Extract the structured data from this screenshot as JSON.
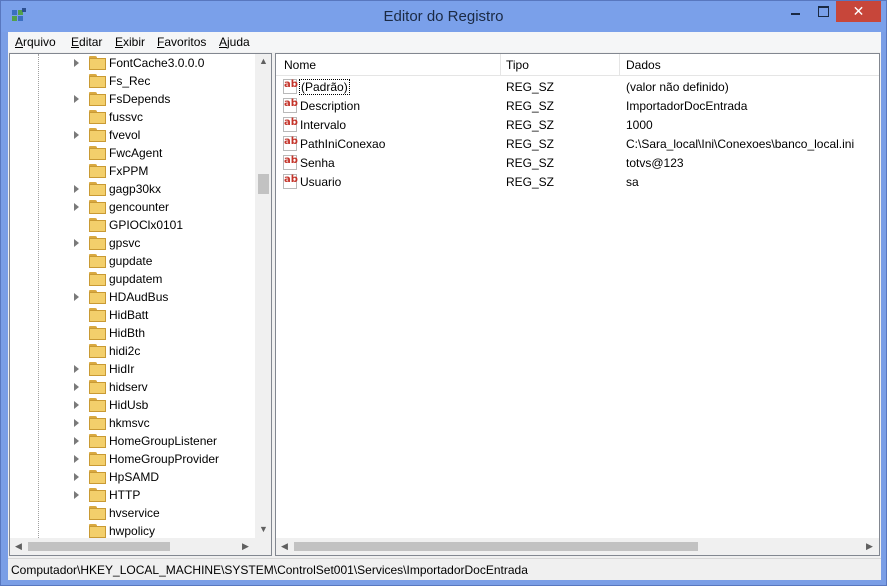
{
  "window": {
    "title": "Editor do Registro",
    "close_glyph": "✕",
    "icon": "registry-editor-icon"
  },
  "menubar": [
    {
      "accel": "A",
      "rest": "rquivo"
    },
    {
      "accel": "E",
      "rest": "ditar"
    },
    {
      "accel": "E",
      "rest": "xibir"
    },
    {
      "accel": "F",
      "rest": "avoritos"
    },
    {
      "accel": "A",
      "rest": "juda"
    }
  ],
  "tree": {
    "items": [
      {
        "label": "FontCache3.0.0.0",
        "expandable": true
      },
      {
        "label": "Fs_Rec",
        "expandable": false
      },
      {
        "label": "FsDepends",
        "expandable": true
      },
      {
        "label": "fussvc",
        "expandable": false
      },
      {
        "label": "fvevol",
        "expandable": true
      },
      {
        "label": "FwcAgent",
        "expandable": false
      },
      {
        "label": "FxPPM",
        "expandable": false
      },
      {
        "label": "gagp30kx",
        "expandable": true
      },
      {
        "label": "gencounter",
        "expandable": true
      },
      {
        "label": "GPIOClx0101",
        "expandable": false
      },
      {
        "label": "gpsvc",
        "expandable": true
      },
      {
        "label": "gupdate",
        "expandable": false
      },
      {
        "label": "gupdatem",
        "expandable": false
      },
      {
        "label": "HDAudBus",
        "expandable": true
      },
      {
        "label": "HidBatt",
        "expandable": false
      },
      {
        "label": "HidBth",
        "expandable": false
      },
      {
        "label": "hidi2c",
        "expandable": false
      },
      {
        "label": "HidIr",
        "expandable": true
      },
      {
        "label": "hidserv",
        "expandable": true
      },
      {
        "label": "HidUsb",
        "expandable": true
      },
      {
        "label": "hkmsvc",
        "expandable": true
      },
      {
        "label": "HomeGroupListener",
        "expandable": true
      },
      {
        "label": "HomeGroupProvider",
        "expandable": true
      },
      {
        "label": "HpSAMD",
        "expandable": true
      },
      {
        "label": "HTTP",
        "expandable": true
      },
      {
        "label": "hvservice",
        "expandable": false
      },
      {
        "label": "hwpolicy",
        "expandable": false
      }
    ]
  },
  "list": {
    "columns": {
      "name": "Nome",
      "type": "Tipo",
      "data": "Dados"
    },
    "rows": [
      {
        "name": "(Padrão)",
        "type": "REG_SZ",
        "data": "(valor não definido)"
      },
      {
        "name": "Description",
        "type": "REG_SZ",
        "data": "ImportadorDocEntrada"
      },
      {
        "name": "Intervalo",
        "type": "REG_SZ",
        "data": "1000"
      },
      {
        "name": "PathIniConexao",
        "type": "REG_SZ",
        "data": "C:\\Sara_local\\Ini\\Conexoes\\banco_local.ini"
      },
      {
        "name": "Senha",
        "type": "REG_SZ",
        "data": "totvs@123"
      },
      {
        "name": "Usuario",
        "type": "REG_SZ",
        "data": "sa"
      }
    ],
    "value_icon_text": "ab"
  },
  "status": {
    "path": "Computador\\HKEY_LOCAL_MACHINE\\SYSTEM\\ControlSet001\\Services\\ImportadorDocEntrada"
  },
  "colors": {
    "titlebar": "#7aa0ea",
    "close": "#c7463a",
    "folder": "#f3cf6b",
    "reg_icon": "#c4342a"
  }
}
